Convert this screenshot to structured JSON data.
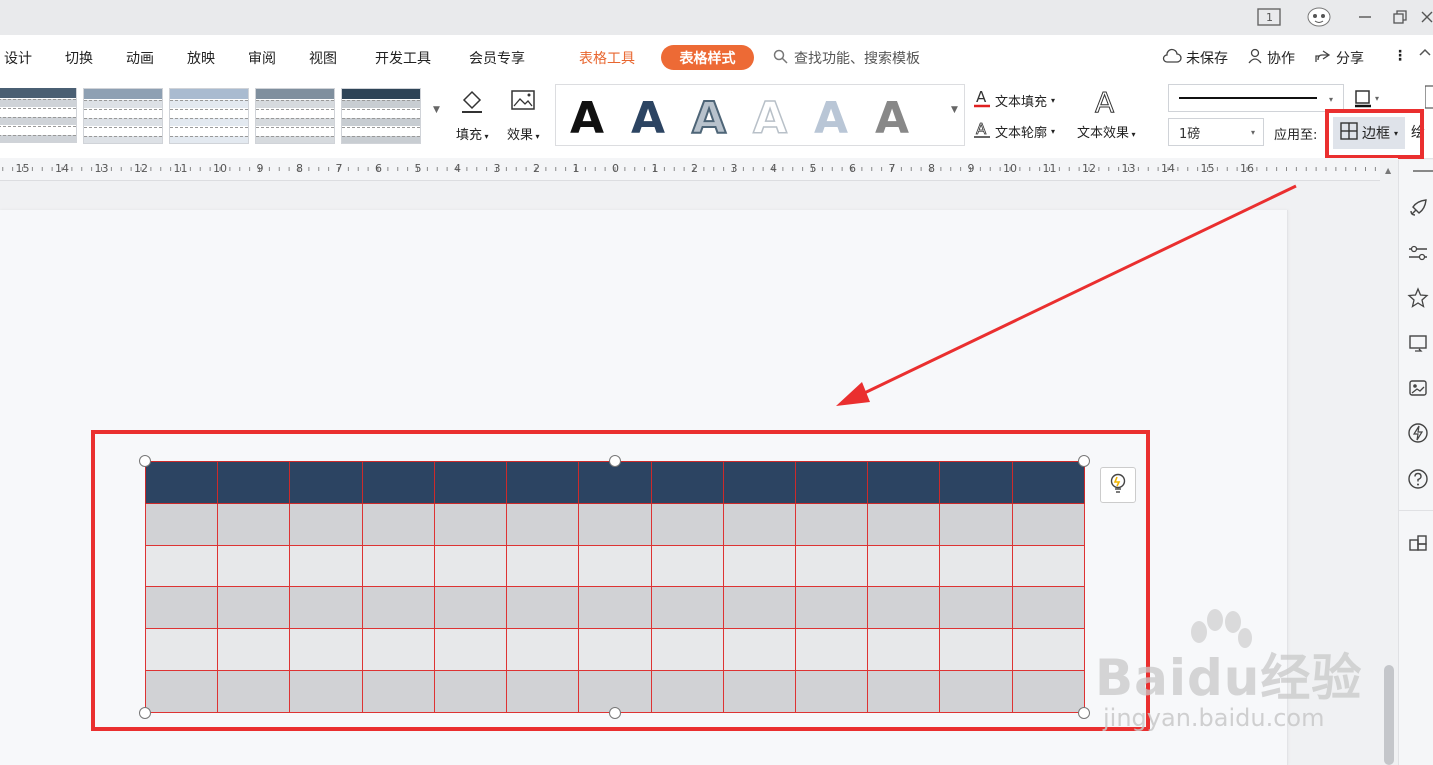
{
  "titlebar": {
    "icons": [
      "page-indicator-icon",
      "avatar-icon",
      "minimize-icon",
      "restore-icon",
      "close-icon"
    ],
    "page_indicator": "1"
  },
  "menu": {
    "items": [
      "设计",
      "切换",
      "动画",
      "放映",
      "审阅",
      "视图",
      "开发工具",
      "会员专享"
    ],
    "table_tools": "表格工具",
    "table_style": "表格样式",
    "search": "查找功能、搜索模板",
    "unsaved": "未保存",
    "collab": "协作",
    "share": "分享",
    "more": "⋮"
  },
  "ribbon": {
    "fill": "填充",
    "effect": "效果",
    "art_letter": "A",
    "text_fill": "文本填充",
    "text_outline": "文本轮廓",
    "text_effect": "文本效果",
    "line_weight": "1磅",
    "apply_to": "应用至:",
    "border": "边框",
    "draw_partial": "绘"
  },
  "ruler": {
    "numbers": [
      "15",
      "14",
      "13",
      "12",
      "11",
      "10",
      "9",
      "8",
      "7",
      "6",
      "5",
      "4",
      "3",
      "2",
      "1",
      "0",
      "1",
      "2",
      "3",
      "4",
      "5",
      "6",
      "7",
      "8",
      "9",
      "10",
      "11",
      "12",
      "13",
      "14",
      "15",
      "16"
    ]
  },
  "table": {
    "columns": 13,
    "header_rows": 1,
    "body_rows": 5,
    "header_color": "#2c4462",
    "border_color": "#cc2a2a",
    "row_colors": [
      "#d1d2d5",
      "#e7e8ea"
    ]
  },
  "colors": {
    "accent": "#ed6a35",
    "annotation": "#ea2f2f"
  },
  "watermark": {
    "logo": "Baidu经验",
    "url": "jingyan.baidu.com"
  }
}
